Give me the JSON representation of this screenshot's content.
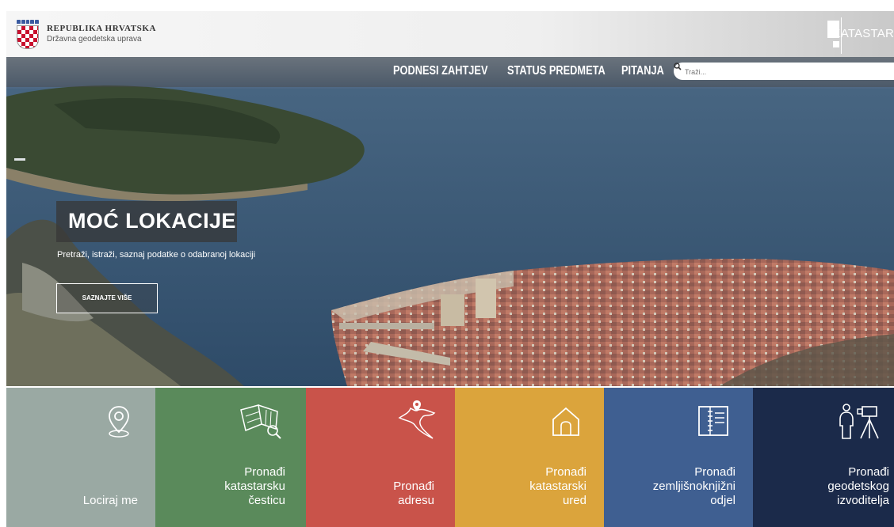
{
  "header": {
    "country": "REPUBLIKA HRVATSKA",
    "agency": "Državna geodetska uprava",
    "app_name": "KATASTAR"
  },
  "nav": {
    "items": [
      "PODNESI ZAHTJEV",
      "STATUS PREDMETA",
      "PITANJA"
    ],
    "search_placeholder": "Traži..."
  },
  "hero": {
    "title": "MOĆ LOKACIJE",
    "subtitle": "Pretraži, istraži, saznaj podatke o odabranoj lokaciji",
    "button": "SAZNAJTE VIŠE"
  },
  "tiles": [
    {
      "lines": [
        "Lociraj me"
      ],
      "color": "#9aa9a3",
      "icon": "location-pin-icon"
    },
    {
      "lines": [
        "Pronađi",
        "katastarsku",
        "česticu"
      ],
      "color": "#5a8a5b",
      "icon": "parcel-map-search-icon"
    },
    {
      "lines": [
        "Pronađi",
        "adresu"
      ],
      "color": "#c9534a",
      "icon": "croatia-map-pin-icon"
    },
    {
      "lines": [
        "Pronađi",
        "katastarski",
        "ured"
      ],
      "color": "#dba43c",
      "icon": "house-icon"
    },
    {
      "lines": [
        "Pronađi",
        "zemljišnoknjižni",
        "odjel"
      ],
      "color": "#3f5f91",
      "icon": "land-registry-book-icon"
    },
    {
      "lines": [
        "Pronađi",
        "geodetskog",
        "izvoditelja"
      ],
      "color": "#1b2a4a",
      "icon": "surveyor-icon"
    }
  ]
}
